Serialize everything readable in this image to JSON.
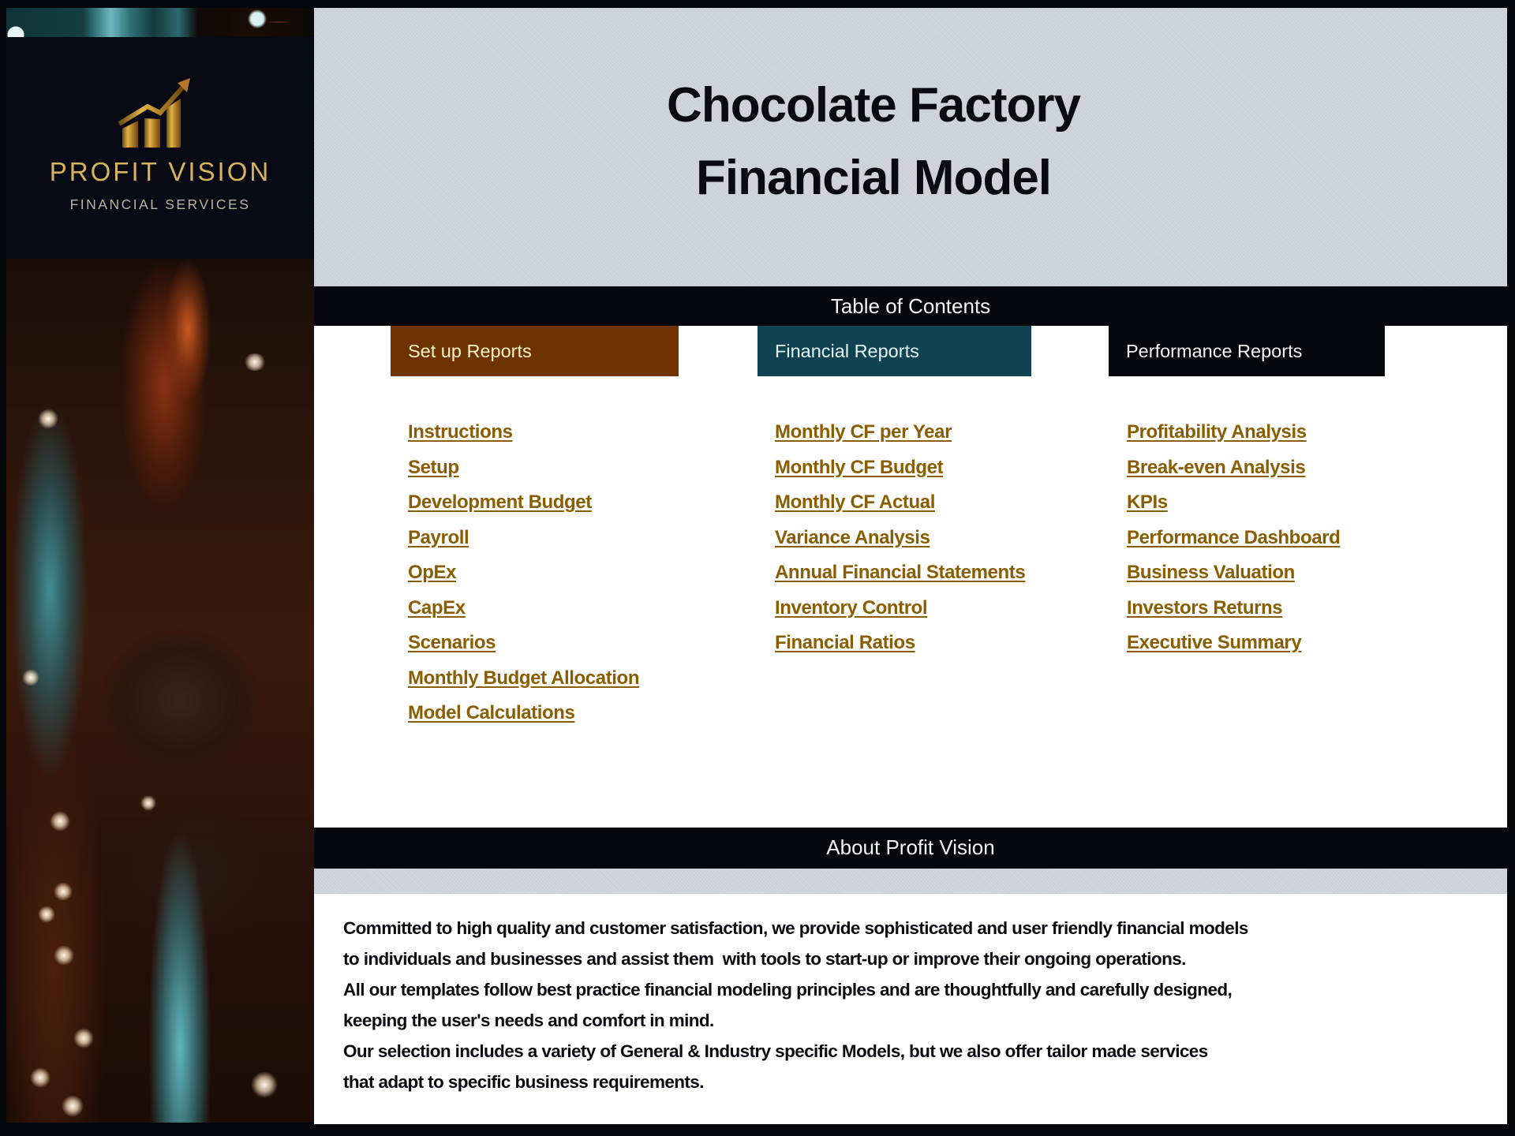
{
  "brand": {
    "name": "PROFIT VISION",
    "subtitle": "FINANCIAL SERVICES",
    "logo_icon": "rising-bar-chart-arrow-icon",
    "gold_color": "#d9b45a"
  },
  "header": {
    "title_line1": "Chocolate Factory",
    "title_line2": "Financial Model"
  },
  "toc": {
    "heading": "Table of Contents",
    "categories": [
      {
        "label": "Set up Reports",
        "color": "#6e3300",
        "links": [
          "Instructions",
          "Setup",
          "Development Budget",
          "Payroll",
          "OpEx",
          "CapEx",
          "Scenarios",
          "Monthly Budget Allocation",
          "Model Calculations"
        ]
      },
      {
        "label": "Financial Reports",
        "color": "#0f4352",
        "links": [
          "Monthly CF per Year",
          "Monthly CF Budget",
          "Monthly CF Actual",
          "Variance Analysis",
          "Annual Financial Statements",
          "Inventory Control",
          "Financial Ratios"
        ]
      },
      {
        "label": "Performance Reports",
        "color": "#05070d",
        "links": [
          "Profitability Analysis",
          "Break-even Analysis",
          "KPIs",
          "Performance Dashboard",
          "Business Valuation",
          "Investors Returns",
          "Executive Summary"
        ]
      }
    ],
    "link_color": "#8a5d00"
  },
  "about": {
    "heading": "About Profit Vision",
    "lines": [
      "Committed to high quality and customer satisfaction, we provide sophisticated and user friendly financial models",
      "to individuals and businesses and assist them  with tools to start-up or improve their ongoing operations.",
      "All our templates follow best practice financial modeling principles and are thoughtfully and carefully designed,",
      "keeping the user's needs and comfort in mind.",
      "Our selection includes a variety of General & Industry specific Models, but we also offer tailor made services",
      "that adapt to specific business requirements."
    ]
  }
}
